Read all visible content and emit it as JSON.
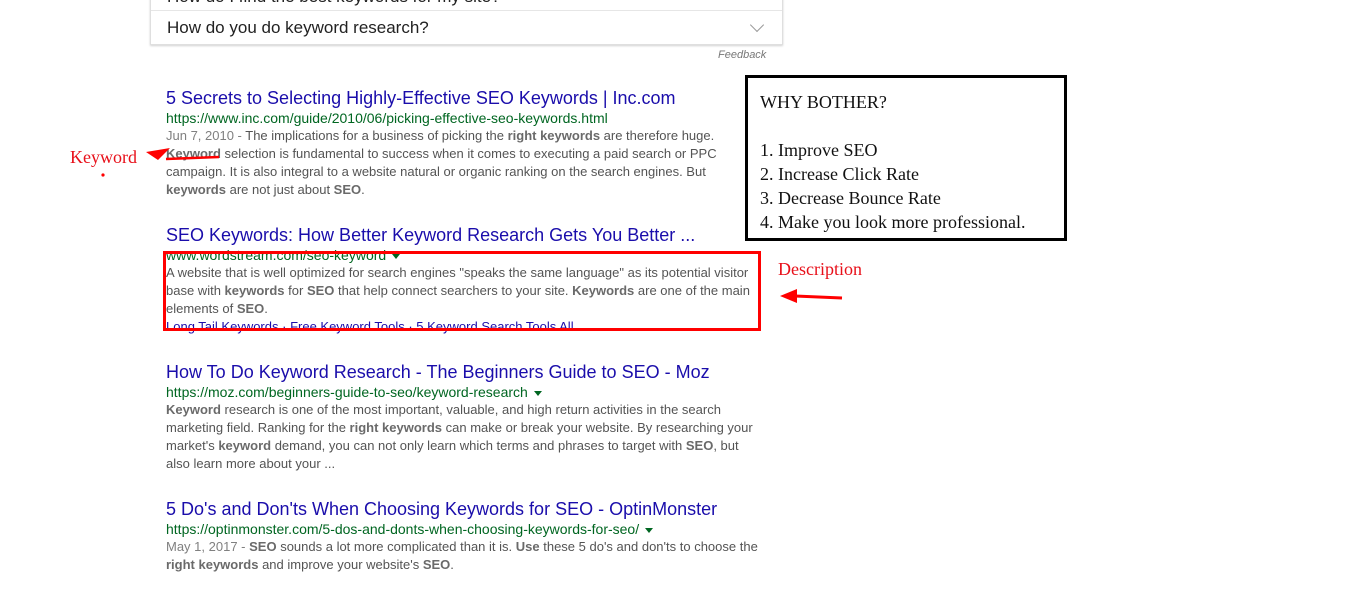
{
  "people_also_ask": {
    "questions": [
      "How do I find the best keywords for my site?",
      "How do you do keyword research?"
    ],
    "feedback_label": "Feedback"
  },
  "results": [
    {
      "title": "5 Secrets to Selecting Highly-Effective SEO Keywords | Inc.com",
      "url": "https://www.inc.com/guide/2010/06/picking-effective-seo-keywords.html",
      "date": "Jun 7, 2010 - ",
      "snippet_parts": [
        {
          "t": "The implications for a business of picking the ",
          "b": false
        },
        {
          "t": "right keywords",
          "b": true
        },
        {
          "t": " are therefore huge. ",
          "b": false
        },
        {
          "t": "Keyword",
          "b": true
        },
        {
          "t": " selection is fundamental to success when it comes to executing a paid search or PPC campaign. It is also integral to a website natural or organic ranking on the search engines. But ",
          "b": false
        },
        {
          "t": "keywords",
          "b": true
        },
        {
          "t": " are not just about ",
          "b": false
        },
        {
          "t": "SEO",
          "b": true
        },
        {
          "t": ".",
          "b": false
        }
      ]
    },
    {
      "title": "SEO Keywords: How Better Keyword Research Gets You Better ...",
      "url": "www.wordstream.com/seo-keyword",
      "snippet_parts": [
        {
          "t": "A website that is well optimized for search engines \"speaks the same language\" as its potential visitor base with ",
          "b": false
        },
        {
          "t": "keywords",
          "b": true
        },
        {
          "t": " for ",
          "b": false
        },
        {
          "t": "SEO",
          "b": true
        },
        {
          "t": " that help connect searchers to your site. ",
          "b": false
        },
        {
          "t": "Keywords",
          "b": true
        },
        {
          "t": " are one of the main elements of ",
          "b": false
        },
        {
          "t": "SEO",
          "b": true
        },
        {
          "t": ".",
          "b": false
        }
      ],
      "sitelinks": [
        "Long Tail Keywords",
        "Free Keyword Tools",
        "5 Keyword Search Tools",
        "All"
      ]
    },
    {
      "title": "How To Do Keyword Research - The Beginners Guide to SEO - Moz",
      "url": "https://moz.com/beginners-guide-to-seo/keyword-research",
      "snippet_parts": [
        {
          "t": "Keyword",
          "b": true
        },
        {
          "t": " research is one of the most important, valuable, and high return activities in the search marketing field. Ranking for the ",
          "b": false
        },
        {
          "t": "right keywords",
          "b": true
        },
        {
          "t": " can make or break your website. By researching your market's ",
          "b": false
        },
        {
          "t": "keyword",
          "b": true
        },
        {
          "t": " demand, you can not only learn which terms and phrases to target with ",
          "b": false
        },
        {
          "t": "SEO",
          "b": true
        },
        {
          "t": ", but also learn more about your ...",
          "b": false
        }
      ]
    },
    {
      "title": "5 Do's and Don'ts When Choosing Keywords for SEO - OptinMonster",
      "url": "https://optinmonster.com/5-dos-and-donts-when-choosing-keywords-for-seo/",
      "date": "May 1, 2017 - ",
      "snippet_parts": [
        {
          "t": "SEO",
          "b": true
        },
        {
          "t": " sounds a lot more complicated than it is. ",
          "b": false
        },
        {
          "t": "Use",
          "b": true
        },
        {
          "t": " these 5 do's and don'ts to choose the ",
          "b": false
        },
        {
          "t": "right keywords",
          "b": true
        },
        {
          "t": " and improve your website's ",
          "b": false
        },
        {
          "t": "SEO",
          "b": true
        },
        {
          "t": ".",
          "b": false
        }
      ]
    }
  ],
  "why_box": {
    "heading": "WHY BOTHER?",
    "items": [
      "1. Improve SEO",
      "2. Increase Click Rate",
      "3. Decrease Bounce Rate",
      "4. Make you look more professional."
    ]
  },
  "annotations": {
    "keyword_label": "Keyword",
    "description_label": "Description",
    "color": "#ff0000"
  }
}
